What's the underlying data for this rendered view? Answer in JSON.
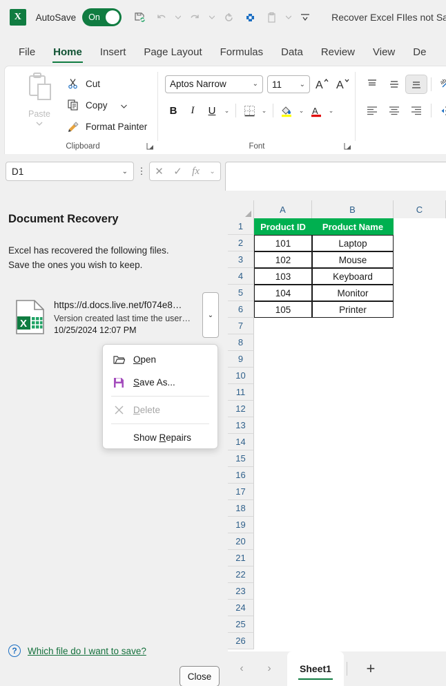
{
  "titlebar": {
    "app_name": "X",
    "autosave_label": "AutoSave",
    "autosave_state": "On",
    "document_title": "Recover Excel FIles not Sa",
    "icons": [
      "save-sync-icon",
      "undo-icon",
      "redo-icon",
      "refresh-icon",
      "customize-icon",
      "clipboard-icon",
      "more-commands-icon"
    ]
  },
  "ribbon": {
    "tabs": [
      {
        "label": "File",
        "active": false
      },
      {
        "label": "Home",
        "active": true
      },
      {
        "label": "Insert",
        "active": false
      },
      {
        "label": "Page Layout",
        "active": false
      },
      {
        "label": "Formulas",
        "active": false
      },
      {
        "label": "Data",
        "active": false
      },
      {
        "label": "Review",
        "active": false
      },
      {
        "label": "View",
        "active": false
      },
      {
        "label": "De",
        "active": false
      }
    ],
    "clipboard": {
      "group_label": "Clipboard",
      "paste_label": "Paste",
      "cut_label": "Cut",
      "copy_label": "Copy",
      "format_painter_label": "Format Painter"
    },
    "font": {
      "group_label": "Font",
      "font_name": "Aptos Narrow",
      "font_size": "11",
      "bold_label": "B",
      "italic_label": "I",
      "underline_label": "U",
      "grow_font_label": "A",
      "shrink_font_label": "A",
      "fill_color": "#ffff00",
      "font_color": "#e00000"
    },
    "alignment": {
      "group_label": ""
    }
  },
  "formula_bar": {
    "name_box_value": "D1",
    "cancel_icon": "✕",
    "enter_icon": "✓",
    "function_icon": "fx",
    "formula_value": ""
  },
  "recovery_pane": {
    "title": "Document Recovery",
    "description_line1": "Excel has recovered the following files.",
    "description_line2": "Save the ones you wish to keep.",
    "file": {
      "name": "https://d.docs.live.net/f074e8…",
      "subtitle": "Version created last time the user…",
      "timestamp": "10/25/2024 12:07 PM"
    },
    "help_link": "Which file do I want to save?",
    "close_label": "Close"
  },
  "context_menu": {
    "items": [
      {
        "id": "open",
        "label": "Open",
        "accel": "O",
        "icon": "folder-open-icon",
        "disabled": false
      },
      {
        "id": "save-as",
        "label": "Save As...",
        "accel": "S",
        "icon": "save-disk-icon",
        "disabled": false
      },
      {
        "id": "delete",
        "label": "Delete",
        "accel": "D",
        "icon": "delete-x-icon",
        "disabled": true
      },
      {
        "id": "show-repairs",
        "label": "Show Repairs",
        "accel": "R",
        "icon": "",
        "disabled": false
      }
    ]
  },
  "grid": {
    "columns": [
      "A",
      "B",
      "C"
    ],
    "rows": [
      1,
      2,
      3,
      4,
      5,
      6,
      7,
      8,
      9,
      10,
      11,
      12,
      13,
      14,
      15,
      16,
      17,
      18,
      19,
      20,
      21,
      22,
      23,
      24,
      25,
      26
    ],
    "header_fill": "#00b050",
    "table": {
      "headers": [
        "Product ID",
        "Product Name"
      ],
      "data": [
        [
          "101",
          "Laptop"
        ],
        [
          "102",
          "Mouse"
        ],
        [
          "103",
          "Keyboard"
        ],
        [
          "104",
          "Monitor"
        ],
        [
          "105",
          "Printer"
        ]
      ]
    }
  },
  "sheet_tabs": {
    "prev_label": "‹",
    "next_label": "›",
    "tabs": [
      "Sheet1"
    ],
    "active_tab": "Sheet1",
    "add_label": "+"
  }
}
